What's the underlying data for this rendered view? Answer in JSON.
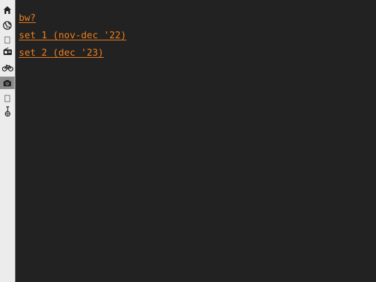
{
  "sidebar": {
    "items": [
      {
        "icon": "house-icon",
        "active": false
      },
      {
        "icon": "globe-icon",
        "active": false
      },
      {
        "icon": "blank-square-icon",
        "active": false
      },
      {
        "icon": "radio-icon",
        "active": false
      },
      {
        "icon": "bicycle-icon",
        "active": false
      },
      {
        "icon": "camera-icon",
        "active": true
      },
      {
        "icon": "blank-square-icon",
        "active": false
      },
      {
        "icon": "unicycle-icon",
        "active": false
      }
    ]
  },
  "main": {
    "links": [
      {
        "label": "bw?"
      },
      {
        "label": "set 1 (nov-dec '22)"
      },
      {
        "label": "set 2 (dec '23)"
      }
    ]
  },
  "colors": {
    "background": "#222222",
    "link": "#f07f1d",
    "sidebar": "#ececec",
    "active_item": "#8c8c8c"
  }
}
